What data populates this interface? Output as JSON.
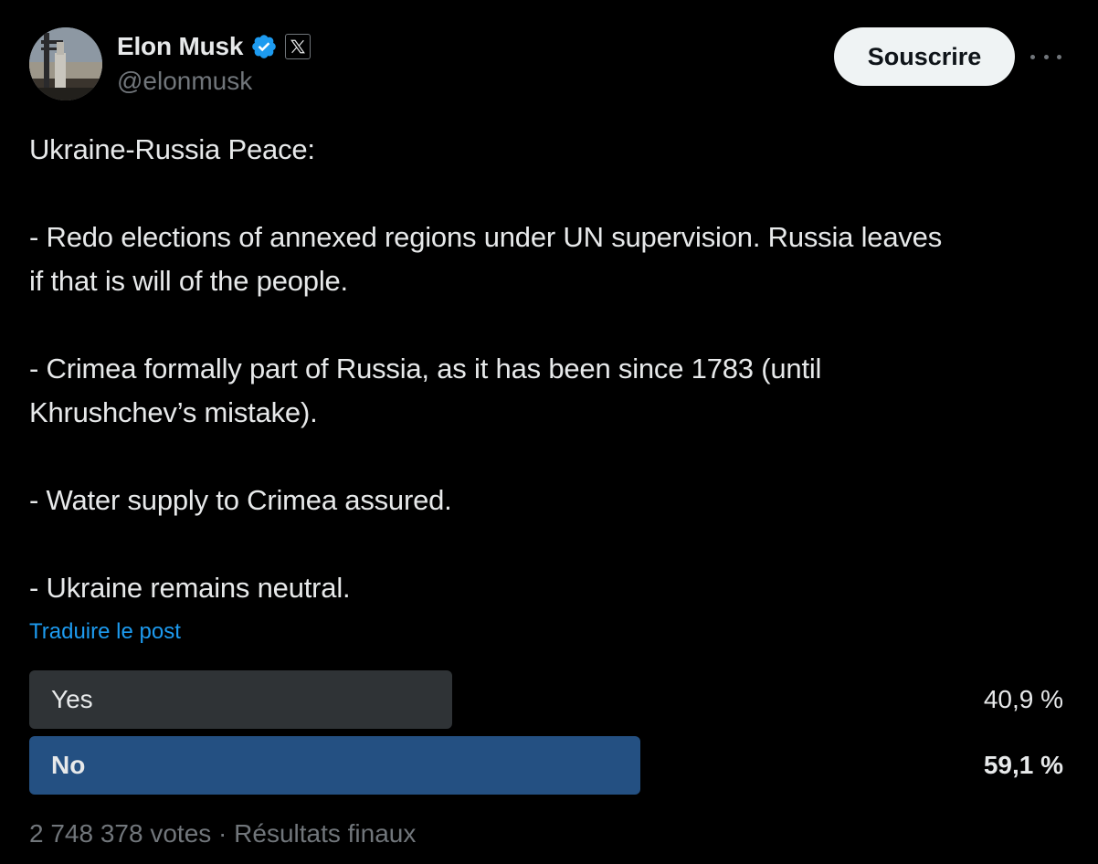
{
  "author": {
    "name": "Elon Musk",
    "handle": "@elonmusk",
    "verified_icon": "verified-badge-icon",
    "affiliation_icon": "x-logo-icon",
    "avatar_icon": "avatar"
  },
  "header": {
    "subscribe_label": "Souscrire",
    "more_icon": "more-horizontal-icon"
  },
  "post": {
    "lines": [
      "Ukraine-Russia Peace:",
      "",
      "- Redo elections of annexed regions under UN supervision. Russia leaves",
      "if that is will of the people.",
      "",
      "- Crimea formally part of Russia, as it has been since 1783 (until",
      "Khrushchev’s mistake).",
      "",
      "- Water supply to Crimea assured.",
      "",
      "- Ukraine remains neutral."
    ],
    "translate_label": "Traduire le post"
  },
  "poll": {
    "options": [
      {
        "label": "Yes",
        "percent": 40.9,
        "percent_label": "40,9 %",
        "winner": false
      },
      {
        "label": "No",
        "percent": 59.1,
        "percent_label": "59,1 %",
        "winner": true
      }
    ],
    "footer": "2 748 378 votes · Résultats finaux"
  },
  "colors": {
    "background": "#000000",
    "text": "#e7e9ea",
    "muted": "#71767b",
    "link": "#1d9bf0",
    "verified": "#1d9bf0",
    "poll_bar": "#2f3336",
    "poll_bar_winner": "#245082",
    "subscribe_bg": "#eff3f4"
  }
}
